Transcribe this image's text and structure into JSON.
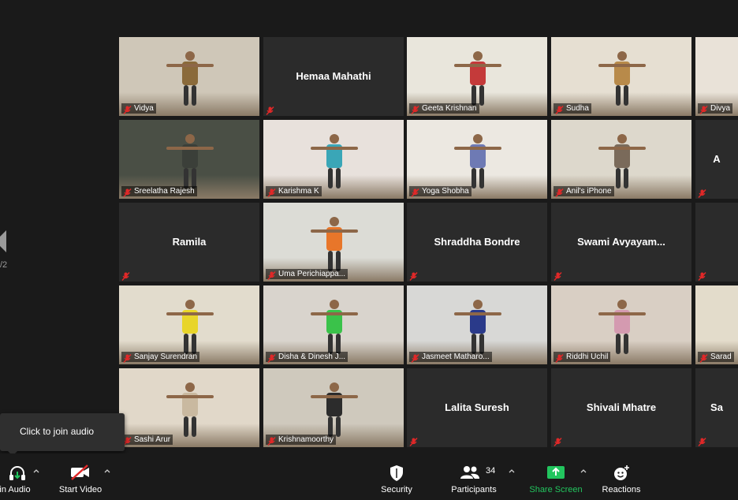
{
  "pagination": {
    "page_indicator": "/2"
  },
  "tooltip": {
    "text": "Click to join audio"
  },
  "tiles": [
    {
      "name": "Vidya",
      "video": true
    },
    {
      "name": "Hemaa Mahathi",
      "video": false
    },
    {
      "name": "Geeta Krishnan",
      "video": true
    },
    {
      "name": "Sudha",
      "video": true
    },
    {
      "name": "Divya",
      "video": true
    },
    {
      "name": "Sreelatha Rajesh",
      "video": true
    },
    {
      "name": "Karishma K",
      "video": true
    },
    {
      "name": "Yoga Shobha",
      "video": true,
      "active_speaker": true
    },
    {
      "name": "Anil's iPhone",
      "video": true
    },
    {
      "name": "A",
      "video": false
    },
    {
      "name": "Ramila",
      "video": false
    },
    {
      "name": "Uma Perichiappa...",
      "video": true
    },
    {
      "name": "Shraddha Bondre",
      "video": false
    },
    {
      "name": "Swami  Avyayam...",
      "video": false
    },
    {
      "name": "",
      "video": false
    },
    {
      "name": "Sanjay Surendran",
      "video": true
    },
    {
      "name": "Disha & Dinesh J...",
      "video": true
    },
    {
      "name": "Jasmeet Matharo...",
      "video": true
    },
    {
      "name": "Riddhi Uchil",
      "video": true
    },
    {
      "name": "Sarad",
      "video": true
    },
    {
      "name": "Sashi Arur",
      "video": true
    },
    {
      "name": "Krishnamoorthy",
      "video": true
    },
    {
      "name": "Lalita Suresh",
      "video": false
    },
    {
      "name": "Shivali Mhatre",
      "video": false
    },
    {
      "name": "Sa",
      "video": false
    }
  ],
  "toolbar": {
    "join_audio": "in Audio",
    "start_video": "Start Video",
    "security": "Security",
    "participants": "Participants",
    "participants_count": "34",
    "share_screen": "Share Screen",
    "reactions": "Reactions"
  },
  "colors": {
    "background": "#1a1a1a",
    "tile": "#2b2b2b",
    "active_border": "#e8e02a",
    "mute_red": "#e02828",
    "share_green": "#22c55e"
  }
}
